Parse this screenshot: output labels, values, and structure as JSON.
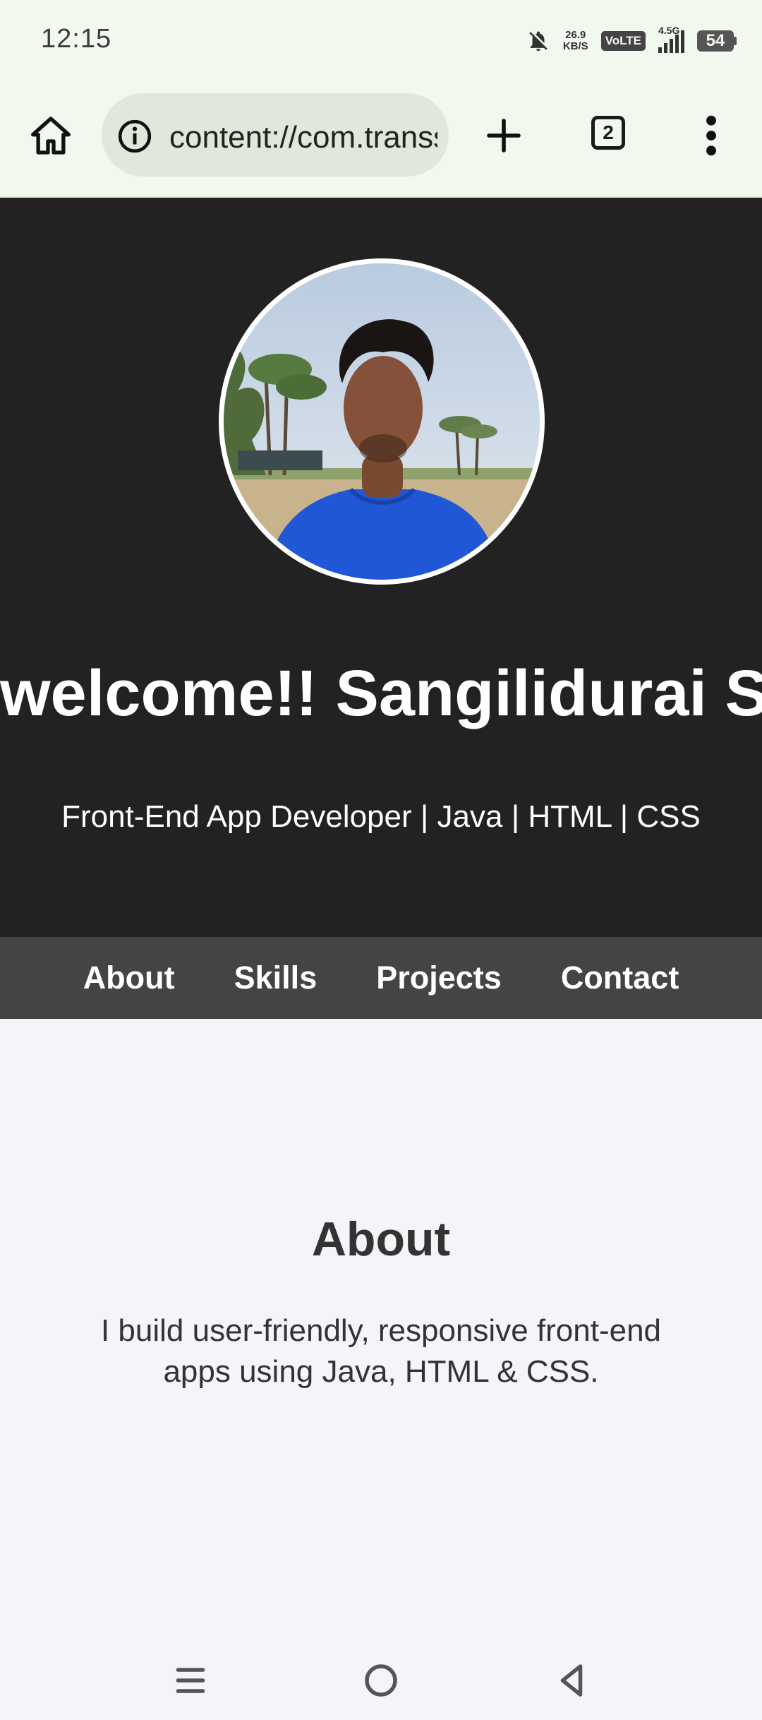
{
  "status_bar": {
    "time": "12:15",
    "net_speed_value": "26.9",
    "net_speed_unit": "KB/S",
    "volte": "VoLTE",
    "network": "4.5G",
    "battery": "54"
  },
  "browser": {
    "url": "content://com.transsion.filemanager",
    "tab_count": "2"
  },
  "header": {
    "title": "welcome!! Sangilidurai S",
    "subtitle": "Front-End App Developer | Java | HTML | CSS"
  },
  "nav": {
    "items": [
      "About",
      "Skills",
      "Projects",
      "Contact"
    ]
  },
  "about": {
    "heading": "About",
    "text": "I build user-friendly, responsive front-end apps using Java, HTML & CSS."
  },
  "colors": {
    "header_bg": "#222222",
    "nav_bg": "#444444",
    "page_bg": "#f4f4f9",
    "browser_chrome": "#f1f9ee"
  }
}
